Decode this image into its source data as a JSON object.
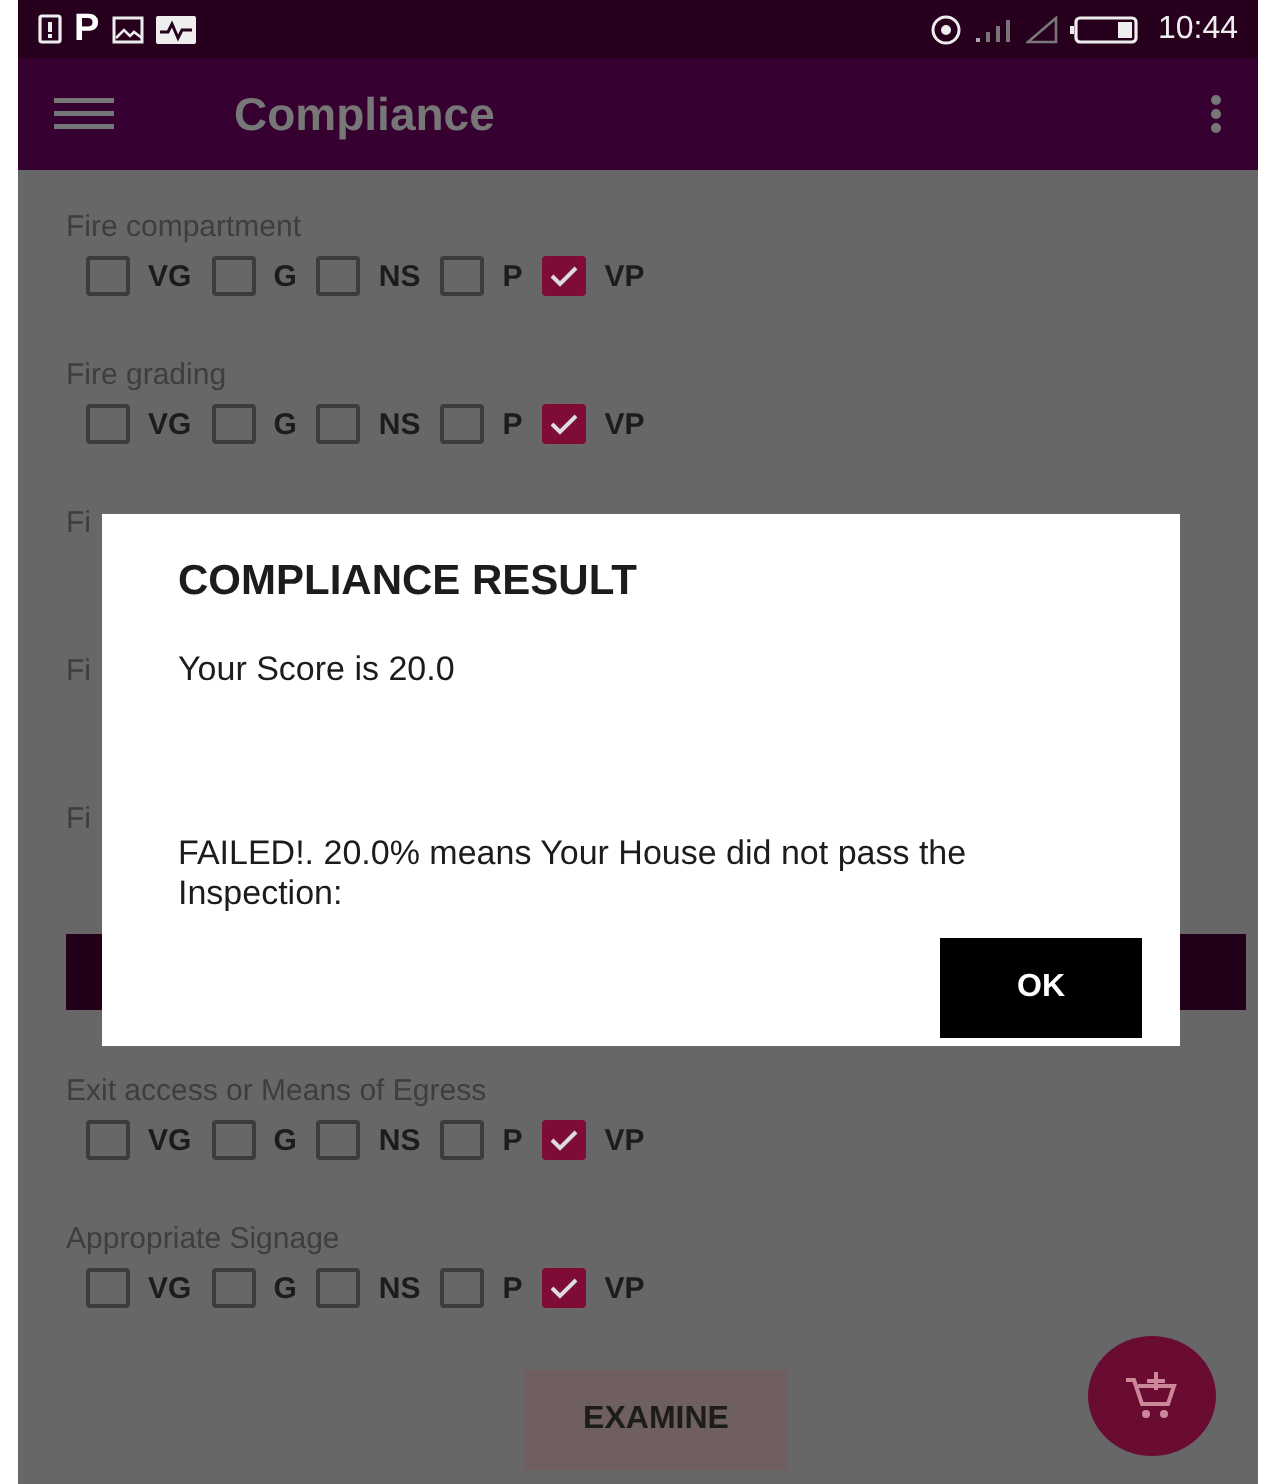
{
  "status_bar": {
    "app_letter": "P",
    "time": "10:44"
  },
  "app_bar": {
    "title": "Compliance"
  },
  "items": [
    {
      "label": "Fire compartment",
      "options": [
        {
          "label": "VG",
          "checked": false
        },
        {
          "label": "G",
          "checked": false
        },
        {
          "label": "NS",
          "checked": false
        },
        {
          "label": "P",
          "checked": false
        },
        {
          "label": "VP",
          "checked": true
        }
      ]
    },
    {
      "label": "Fire grading",
      "options": [
        {
          "label": "VG",
          "checked": false
        },
        {
          "label": "G",
          "checked": false
        },
        {
          "label": "NS",
          "checked": false
        },
        {
          "label": "P",
          "checked": false
        },
        {
          "label": "VP",
          "checked": true
        }
      ]
    },
    {
      "label": "Fi"
    },
    {
      "label": "Fi"
    },
    {
      "label": "Fi"
    }
  ],
  "items_after_header": [
    {
      "label": "Exit access or Means of Egress",
      "options": [
        {
          "label": "VG",
          "checked": false
        },
        {
          "label": "G",
          "checked": false
        },
        {
          "label": "NS",
          "checked": false
        },
        {
          "label": "P",
          "checked": false
        },
        {
          "label": "VP",
          "checked": true
        }
      ]
    },
    {
      "label": "Appropriate Signage",
      "options": [
        {
          "label": "VG",
          "checked": false
        },
        {
          "label": "G",
          "checked": false
        },
        {
          "label": "NS",
          "checked": false
        },
        {
          "label": "P",
          "checked": false
        },
        {
          "label": "VP",
          "checked": true
        }
      ]
    }
  ],
  "examine_button": "EXAMINE",
  "dialog": {
    "title": "COMPLIANCE RESULT",
    "score": "Your Score is 20.0",
    "message": "FAILED!. 20.0% means Your House did not pass the Inspection:",
    "ok": "OK"
  }
}
